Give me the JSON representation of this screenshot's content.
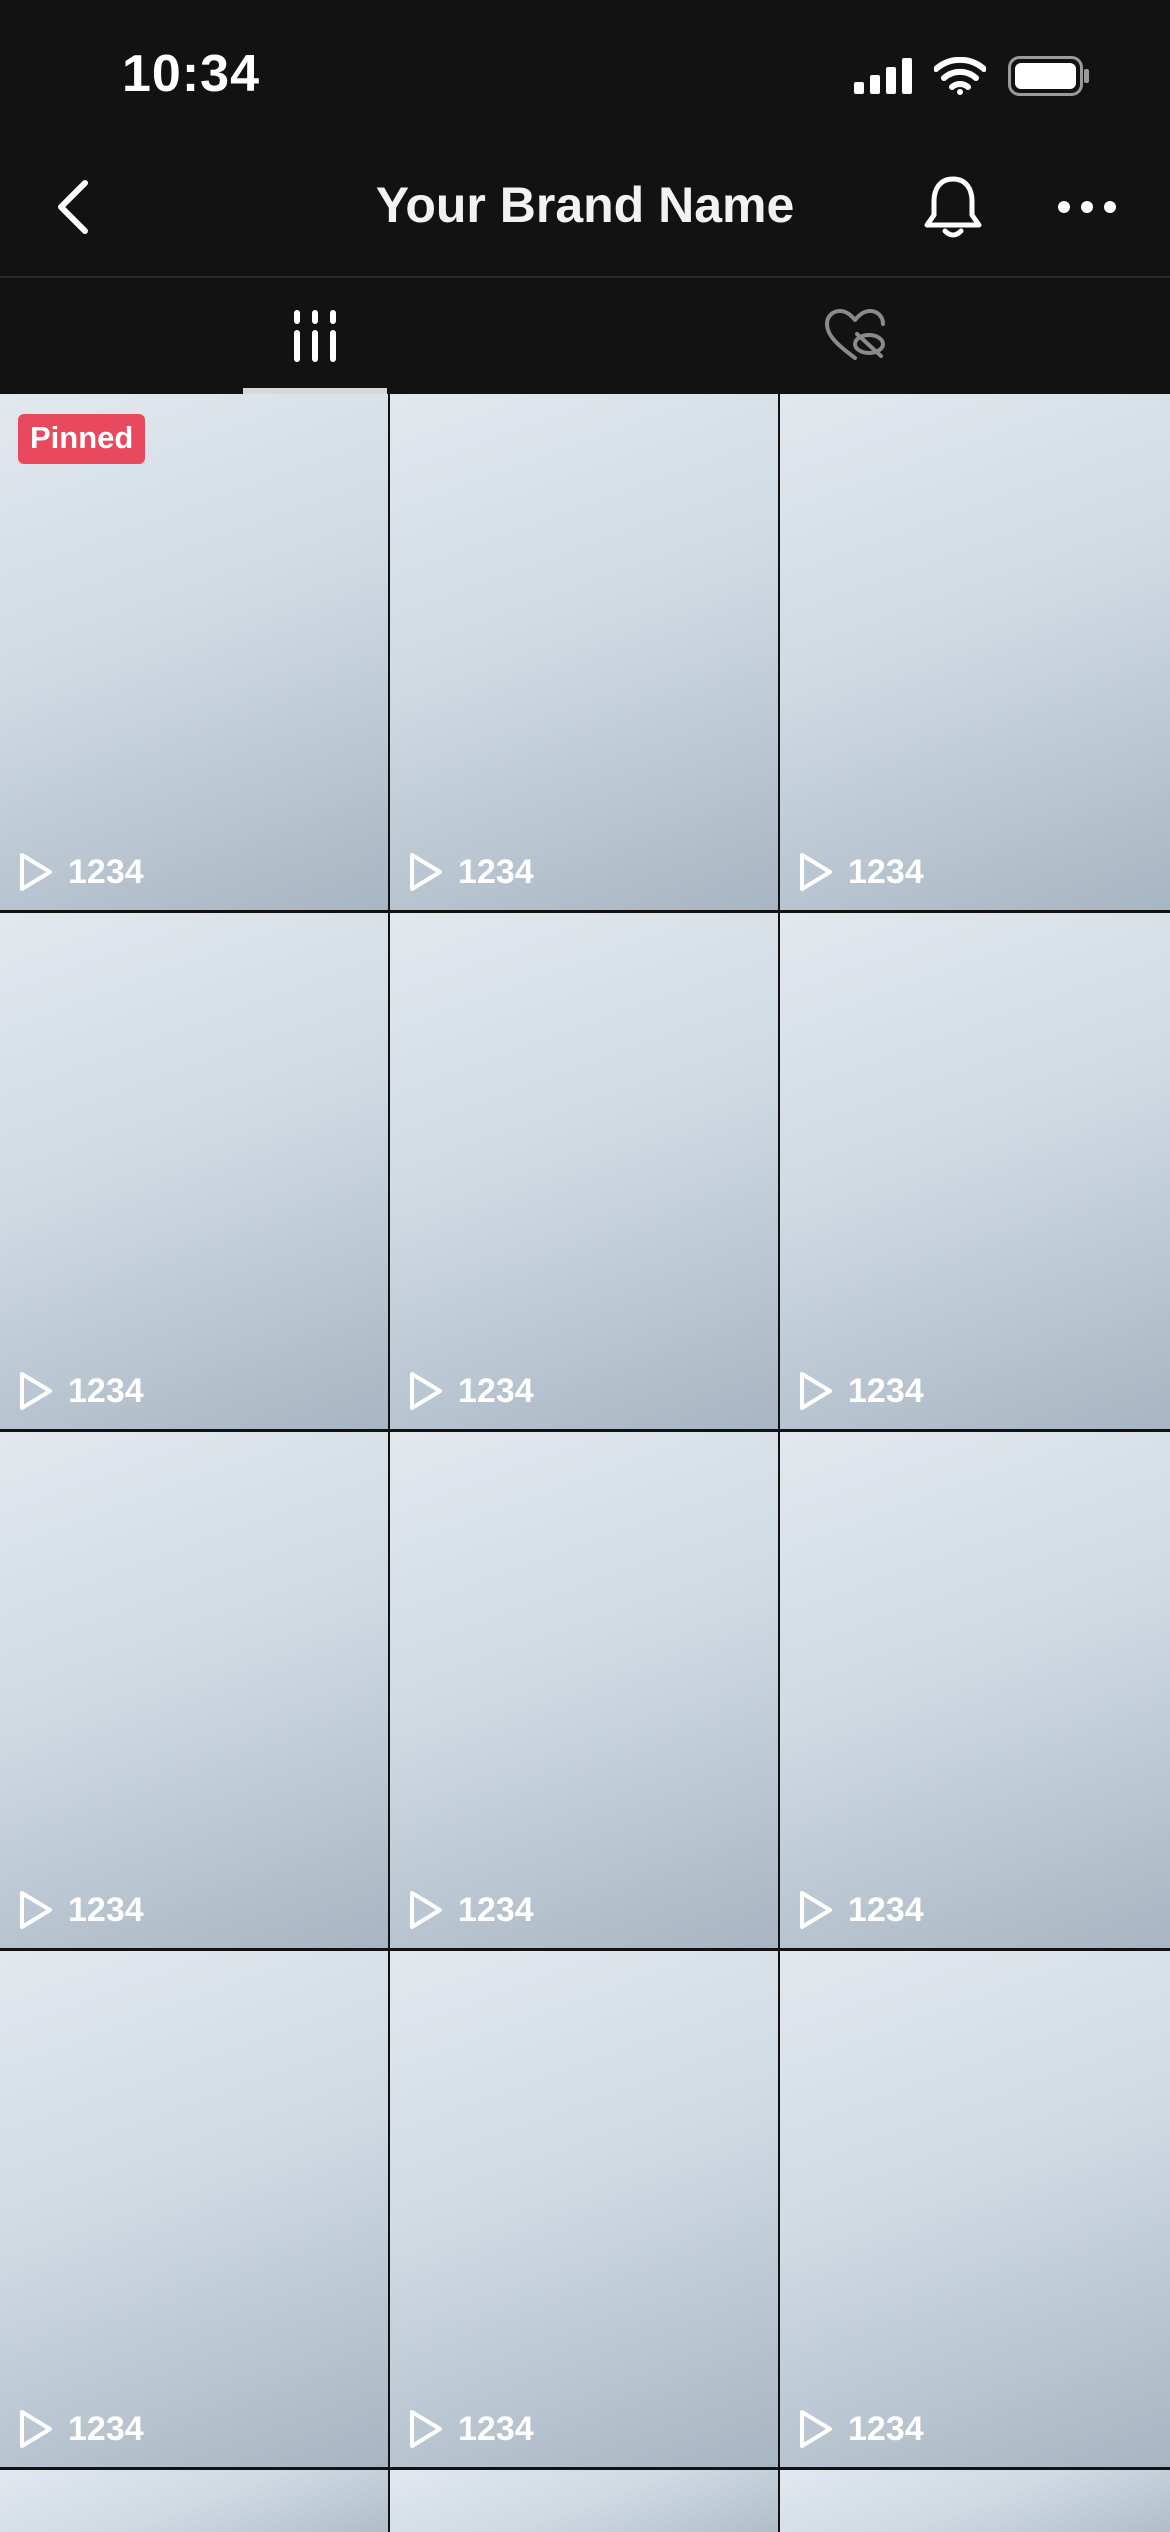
{
  "status_bar": {
    "time": "10:34",
    "icons": [
      "cellular-signal-icon",
      "wifi-icon",
      "battery-icon"
    ]
  },
  "header": {
    "title": "Your Brand Name",
    "back_icon": "chevron-left-icon",
    "bell_icon": "bell-icon",
    "more_icon": "more-horizontal-icon"
  },
  "tabs": [
    {
      "name": "videos",
      "icon": "grid-columns-icon",
      "active": true
    },
    {
      "name": "liked",
      "icon": "hidden-heart-icon",
      "active": false
    }
  ],
  "videos": [
    {
      "pinned": true,
      "badge": "Pinned",
      "views": "1234"
    },
    {
      "pinned": false,
      "views": "1234"
    },
    {
      "pinned": false,
      "views": "1234"
    },
    {
      "pinned": false,
      "views": "1234"
    },
    {
      "pinned": false,
      "views": "1234"
    },
    {
      "pinned": false,
      "views": "1234"
    },
    {
      "pinned": false,
      "views": "1234"
    },
    {
      "pinned": false,
      "views": "1234"
    },
    {
      "pinned": false,
      "views": "1234"
    },
    {
      "pinned": false,
      "views": "1234"
    },
    {
      "pinned": false,
      "views": "1234"
    },
    {
      "pinned": false,
      "views": "1234"
    }
  ],
  "colors": {
    "background": "#121212",
    "pinned_badge": "#e8495e",
    "tab_indicator": "#d8d8d8"
  }
}
